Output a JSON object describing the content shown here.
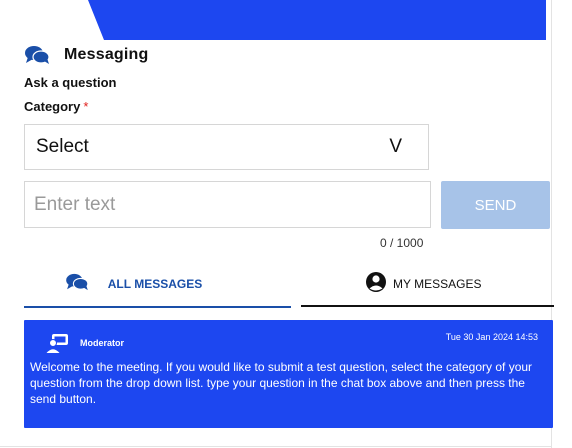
{
  "colors": {
    "banner": "#1d47f0",
    "accent": "#1a4fa8",
    "send_disabled": "#a7c3e8",
    "card": "#1d47f0",
    "required": "#e0201c"
  },
  "header": {
    "icon": "chat-bubbles-icon",
    "title": "Messaging"
  },
  "form": {
    "ask_label": "Ask a question",
    "category_label": "Category",
    "required_mark": "*",
    "category_select": {
      "value": "Select",
      "caret": "V"
    },
    "text_input": {
      "placeholder": "Enter text",
      "value": ""
    },
    "send_label": "SEND",
    "char_counter": "0 / 1000"
  },
  "tabs": [
    {
      "label": "ALL MESSAGES",
      "icon": "chat-bubbles-icon",
      "active": true
    },
    {
      "label": "MY MESSAGES",
      "icon": "user-circle-icon",
      "active": false
    }
  ],
  "messages": [
    {
      "author": "Moderator",
      "avatar_icon": "moderator-icon",
      "timestamp": "Tue 30 Jan 2024 14:53",
      "body": "Welcome to the meeting. If you would like to submit a test question, select the category of your question from the drop down list. type your question in the chat box above and then press the send button."
    }
  ]
}
